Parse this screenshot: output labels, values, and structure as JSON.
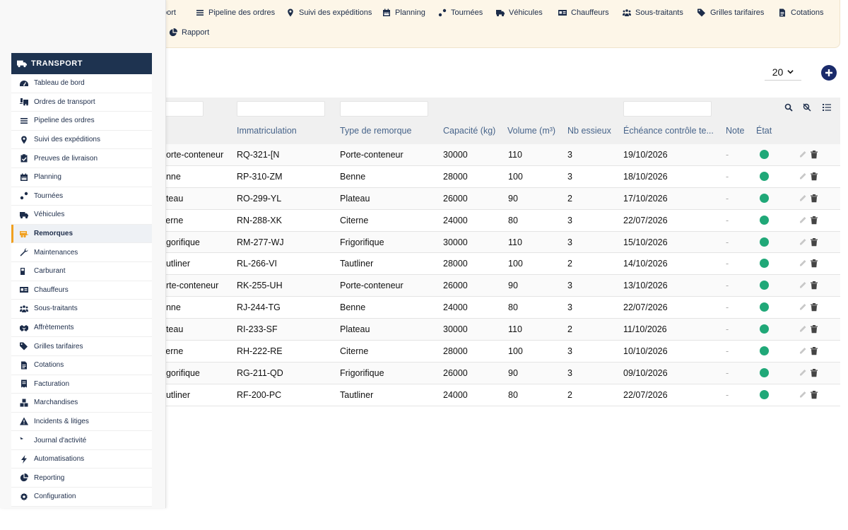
{
  "topnav": {
    "row1": [
      {
        "label": "port",
        "icon": "none"
      },
      {
        "label": "Pipeline des ordres",
        "icon": "list-icon"
      },
      {
        "label": "Suivi des expéditions",
        "icon": "map-pin-icon"
      },
      {
        "label": "Planning",
        "icon": "calendar-icon"
      },
      {
        "label": "Tournées",
        "icon": "route-icon"
      },
      {
        "label": "Véhicules",
        "icon": "truck-icon"
      },
      {
        "label": "Chauffeurs",
        "icon": "id-card-icon"
      },
      {
        "label": "Sous-traitants",
        "icon": "people-icon"
      },
      {
        "label": "Grilles tarifaires",
        "icon": "tags-icon"
      },
      {
        "label": "Cotations",
        "icon": "document-icon"
      }
    ],
    "row2": [
      {
        "label": "Rapport",
        "icon": "pie-chart-icon"
      }
    ]
  },
  "sidebar": {
    "header": "TRANSPORT",
    "items": [
      {
        "label": "Tableau de bord",
        "icon": "dashboard-icon"
      },
      {
        "label": "Ordres de transport",
        "icon": "truck-loading-icon"
      },
      {
        "label": "Pipeline des ordres",
        "icon": "list-icon"
      },
      {
        "label": "Suivi des expéditions",
        "icon": "map-pin-icon"
      },
      {
        "label": "Preuves de livraison",
        "icon": "clipboard-check-icon"
      },
      {
        "label": "Planning",
        "icon": "calendar-icon"
      },
      {
        "label": "Tournées",
        "icon": "route-icon"
      },
      {
        "label": "Véhicules",
        "icon": "truck-icon"
      },
      {
        "label": "Remorques",
        "icon": "trailer-icon",
        "active": true
      },
      {
        "label": "Maintenances",
        "icon": "wrench-icon"
      },
      {
        "label": "Carburant",
        "icon": "fuel-icon"
      },
      {
        "label": "Chauffeurs",
        "icon": "id-card-icon"
      },
      {
        "label": "Sous-traitants",
        "icon": "people-icon"
      },
      {
        "label": "Affrètements",
        "icon": "handshake-icon"
      },
      {
        "label": "Grilles tarifaires",
        "icon": "tags-icon"
      },
      {
        "label": "Cotations",
        "icon": "document-icon"
      },
      {
        "label": "Facturation",
        "icon": "invoice-icon"
      },
      {
        "label": "Marchandises",
        "icon": "boxes-icon"
      },
      {
        "label": "Incidents & litiges",
        "icon": "warning-icon"
      },
      {
        "label": "Journal d'activité",
        "icon": "history-icon"
      },
      {
        "label": "Automatisations",
        "icon": "bolt-icon"
      },
      {
        "label": "Reporting",
        "icon": "pie-chart-icon"
      },
      {
        "label": "Configuration",
        "icon": "gear-icon"
      }
    ]
  },
  "toolbar": {
    "page_size": "20"
  },
  "table": {
    "headers": [
      "Immatriculation",
      "Type de remorque",
      "Capacité (kg)",
      "Volume (m³)",
      "Nb essieux",
      "Échéance contrôle te...",
      "Note",
      "État"
    ],
    "rows": [
      {
        "type_cut": "porte-conteneur",
        "immat": "RQ-321-[N",
        "type": "Porte-conteneur",
        "capacite": "30000",
        "volume": "110",
        "essieux": "3",
        "echeance": "19/10/2026",
        "note": "-"
      },
      {
        "type_cut": "enne",
        "immat": "RP-310-ZM",
        "type": "Benne",
        "capacite": "28000",
        "volume": "100",
        "essieux": "3",
        "echeance": "18/10/2026",
        "note": "-"
      },
      {
        "type_cut": "ateau",
        "immat": "RO-299-YL",
        "type": "Plateau",
        "capacite": "26000",
        "volume": "90",
        "essieux": "2",
        "echeance": "17/10/2026",
        "note": "-"
      },
      {
        "type_cut": "iterne",
        "immat": "RN-288-XK",
        "type": "Citerne",
        "capacite": "24000",
        "volume": "80",
        "essieux": "3",
        "echeance": "22/07/2026",
        "note": "-"
      },
      {
        "type_cut": "rigorifique",
        "immat": "RM-277-WJ",
        "type": "Frigorifique",
        "capacite": "30000",
        "volume": "110",
        "essieux": "3",
        "echeance": "15/10/2026",
        "note": "-"
      },
      {
        "type_cut": "autliner",
        "immat": "RL-266-VI",
        "type": "Tautliner",
        "capacite": "28000",
        "volume": "100",
        "essieux": "2",
        "echeance": "14/10/2026",
        "note": "-"
      },
      {
        "type_cut": "orte-conteneur",
        "immat": "RK-255-UH",
        "type": "Porte-conteneur",
        "capacite": "26000",
        "volume": "90",
        "essieux": "3",
        "echeance": "13/10/2026",
        "note": "-"
      },
      {
        "type_cut": "enne",
        "immat": "RJ-244-TG",
        "type": "Benne",
        "capacite": "24000",
        "volume": "80",
        "essieux": "3",
        "echeance": "22/07/2026",
        "note": "-"
      },
      {
        "type_cut": "ateau",
        "immat": "RI-233-SF",
        "type": "Plateau",
        "capacite": "30000",
        "volume": "110",
        "essieux": "2",
        "echeance": "11/10/2026",
        "note": "-"
      },
      {
        "type_cut": "iterne",
        "immat": "RH-222-RE",
        "type": "Citerne",
        "capacite": "28000",
        "volume": "100",
        "essieux": "3",
        "echeance": "10/10/2026",
        "note": "-"
      },
      {
        "type_cut": "rigorifique",
        "immat": "RG-211-QD",
        "type": "Frigorifique",
        "capacite": "26000",
        "volume": "90",
        "essieux": "3",
        "echeance": "09/10/2026",
        "note": "-"
      },
      {
        "type_cut": "autliner",
        "immat": "RF-200-PC",
        "type": "Tautliner",
        "capacite": "24000",
        "volume": "80",
        "essieux": "2",
        "echeance": "22/07/2026",
        "note": "-"
      }
    ]
  },
  "colors": {
    "status_ok": "#20a878",
    "sidebar_header": "#1e3350",
    "active_accent": "#f0a020",
    "add_button": "#1a2b6b"
  }
}
